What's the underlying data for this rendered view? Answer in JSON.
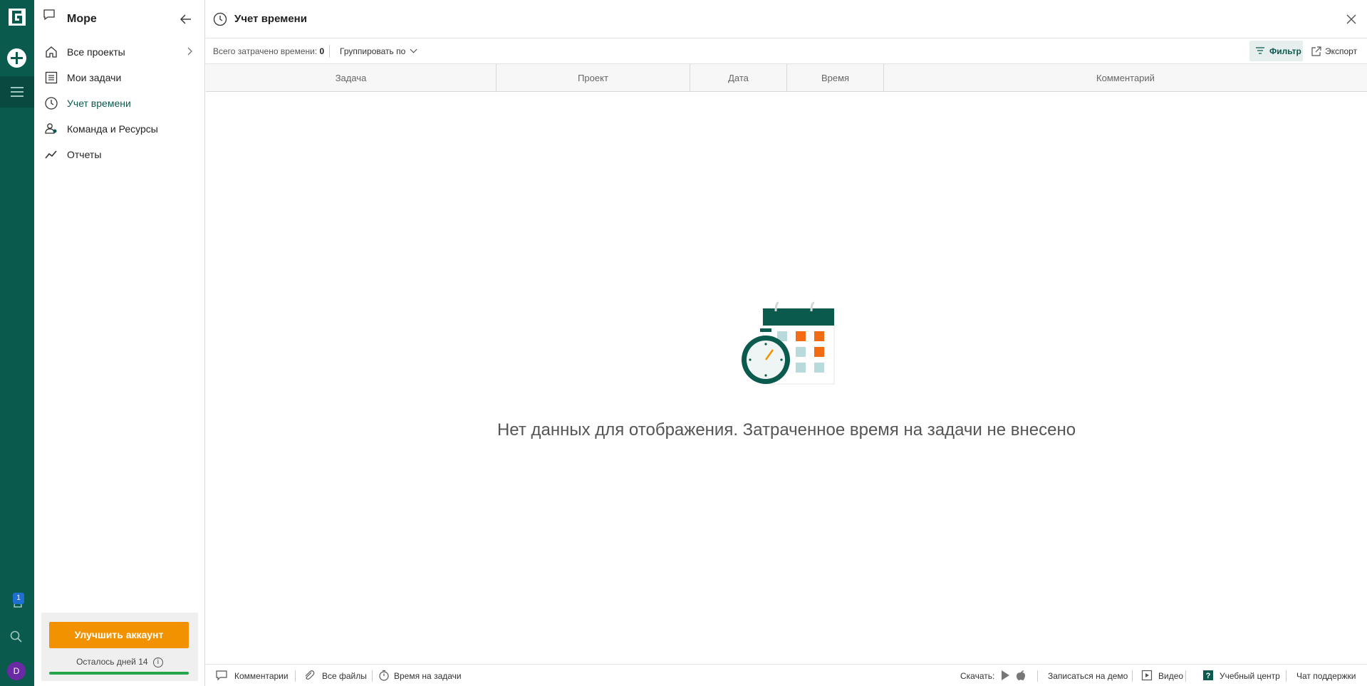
{
  "rail": {
    "notification_count": "1",
    "avatar_letter": "D",
    "colors": {
      "bg": "#0b5a4e",
      "badge": "#1d6fd1",
      "avatar": "#6a2aa3"
    }
  },
  "sidebar": {
    "workspace_title": "Море",
    "items": [
      {
        "label": "Все проекты",
        "icon": "home-icon"
      },
      {
        "label": "Мои задачи",
        "icon": "list-icon"
      },
      {
        "label": "Учет времени",
        "icon": "clock-icon",
        "active": true
      },
      {
        "label": "Команда и Ресурсы",
        "icon": "team-icon"
      },
      {
        "label": "Отчеты",
        "icon": "chart-icon"
      }
    ],
    "upgrade": {
      "button_label": "Улучшить аккаунт",
      "days_left_text": "Осталось дней 14",
      "info_symbol": "i",
      "progress_fraction": 1.0
    }
  },
  "header": {
    "title": "Учет времени"
  },
  "toolbar": {
    "total_label": "Всего затрачено времени:",
    "total_value": "0",
    "group_label": "Группировать по",
    "filter_label": "Фильтр",
    "export_label": "Экспорт"
  },
  "table": {
    "columns": [
      "Задача",
      "Проект",
      "Дата",
      "Время",
      "Комментарий"
    ]
  },
  "empty_state": {
    "message": "Нет данных для отображения. Затраченное время на задачи не внесено"
  },
  "footer": {
    "left": [
      "Комментарии",
      "Все файлы",
      "Время на задачи"
    ],
    "download_label": "Скачать:",
    "demo_label": "Записаться на демо",
    "video_label": "Видео",
    "learning_label": "Учебный центр",
    "chat_label": "Чат поддержки"
  },
  "colors": {
    "accent": "#0b5a4e",
    "orange": "#f39200",
    "progress": "#26a64b"
  }
}
